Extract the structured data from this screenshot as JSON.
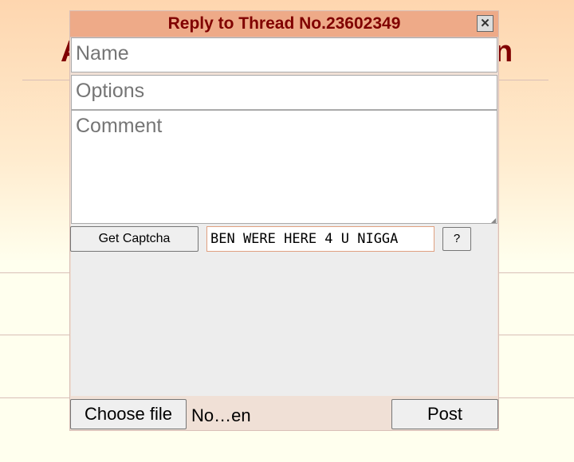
{
  "background": {
    "title_left": "A",
    "title_right": "n"
  },
  "quick_reply": {
    "title": "Reply to Thread No.23602349",
    "close_icon": "close-icon",
    "name_placeholder": "Name",
    "options_placeholder": "Options",
    "comment_placeholder": "Comment",
    "get_captcha_label": "Get Captcha",
    "captcha_value": "BEN WERE HERE 4 U NIGGA",
    "captcha_help_label": "?",
    "choose_file_label": "Choose file",
    "file_status": "No…en",
    "post_label": "Post"
  },
  "colors": {
    "header_bg": "#eeaa88",
    "header_text": "#800000",
    "panel_bg": "#f0e0d6"
  }
}
